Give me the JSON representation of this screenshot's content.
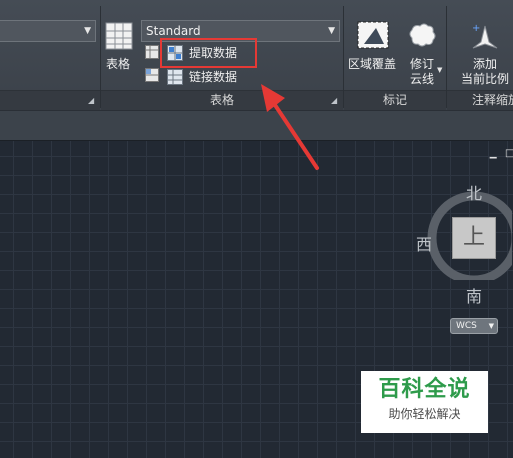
{
  "ribbon": {
    "table_group": {
      "group_label": "表格",
      "table_button_label": "表格",
      "style_dropdown_value": "Standard",
      "extract_data_label": "提取数据",
      "link_data_label": "链接数据"
    },
    "markup_group": {
      "group_label": "标记",
      "wipeout_label": "区域覆盖",
      "revcloud_label_line1": "修订",
      "revcloud_label_line2": "云线"
    },
    "annotation_scale_group": {
      "group_label": "注释缩放",
      "add_scale_label_line1": "添加",
      "add_scale_label_line2": "当前比例"
    }
  },
  "viewcube": {
    "north": "北",
    "west": "西",
    "south": "南",
    "top_face": "上",
    "coordinate_system": "WCS"
  },
  "watermark": {
    "title": "百科全说",
    "subtitle": "助你轻松解决"
  },
  "colors": {
    "highlight": "#e53935",
    "brand_green": "#2e9b4b"
  }
}
